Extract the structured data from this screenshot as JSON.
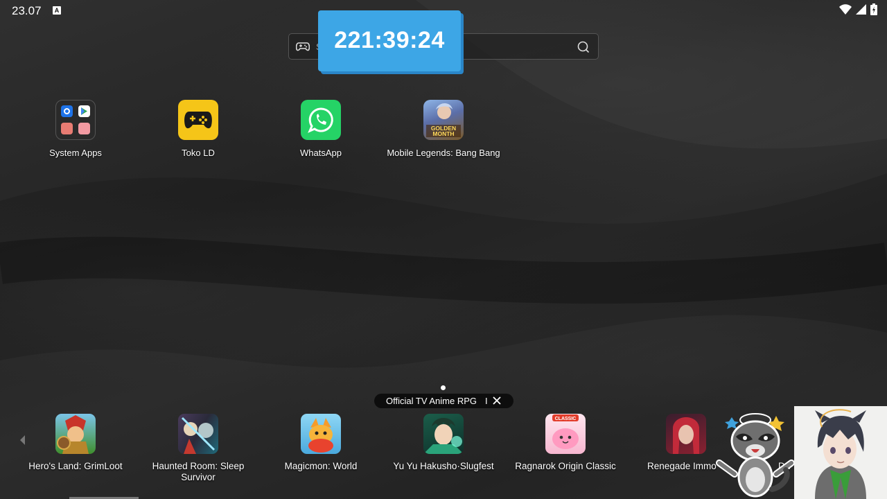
{
  "status_bar": {
    "time": "23.07",
    "notification_badge": "A",
    "icons": [
      "wifi-icon",
      "signal-icon",
      "battery-icon"
    ]
  },
  "search": {
    "placeholder": "S",
    "icon_left": "gamepad-icon",
    "icon_right": "search-icon"
  },
  "timer_overlay": {
    "value": "221:39:24",
    "color": "#3da6e6"
  },
  "home_apps": [
    {
      "label": "System Apps",
      "icon": "folder-icon"
    },
    {
      "label": "Toko LD",
      "icon": "gamepad-icon",
      "color": "#f5c518"
    },
    {
      "label": "WhatsApp",
      "icon": "whatsapp-icon",
      "color": "#25d366"
    },
    {
      "label": "Mobile Legends: Bang Bang",
      "icon": "game-art-icon",
      "badge": "GOLDEN MONTH"
    }
  ],
  "ad_banner": {
    "text": "Official TV Anime RPG",
    "separator": "I",
    "close_icon": "close-icon"
  },
  "dock_apps": [
    {
      "label": "Hero's Land: GrimLoot"
    },
    {
      "label": "Haunted Room: Sleep Survivor"
    },
    {
      "label": "Magicmon: World"
    },
    {
      "label": "Yu Yu Hakusho·Slugfest"
    },
    {
      "label": "Ragnarok Origin Classic",
      "badge": "CLASSIC"
    },
    {
      "label": "Renegade Immo"
    },
    {
      "label": "Drag"
    }
  ]
}
